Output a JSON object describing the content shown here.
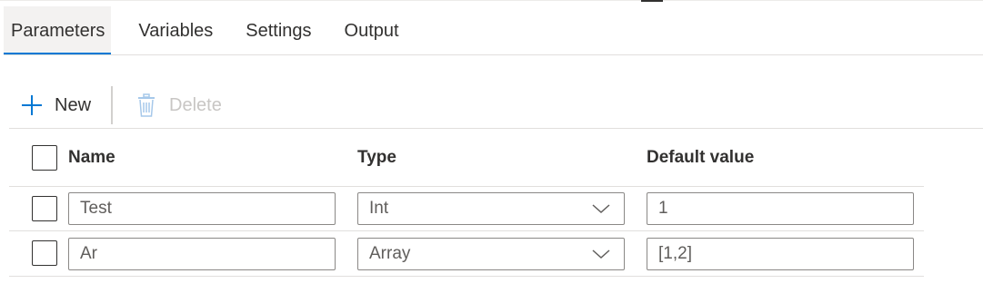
{
  "tabs": [
    {
      "label": "Parameters",
      "active": true
    },
    {
      "label": "Variables",
      "active": false
    },
    {
      "label": "Settings",
      "active": false
    },
    {
      "label": "Output",
      "active": false
    }
  ],
  "toolbar": {
    "new_label": "New",
    "new_icon": "plus-icon",
    "delete_label": "Delete",
    "delete_icon": "trash-icon",
    "delete_disabled": true
  },
  "grid": {
    "headers": {
      "name": "Name",
      "type": "Type",
      "default_value": "Default value"
    },
    "rows": [
      {
        "name": "Test",
        "type": "Int",
        "default_value": "1"
      },
      {
        "name": "Ar",
        "type": "Array",
        "default_value": "[1,2]"
      }
    ]
  },
  "colors": {
    "accent": "#0078d4",
    "active_tab_bg": "#f3f2f1",
    "text": "#323130",
    "disabled_text": "#c8c6c4"
  }
}
